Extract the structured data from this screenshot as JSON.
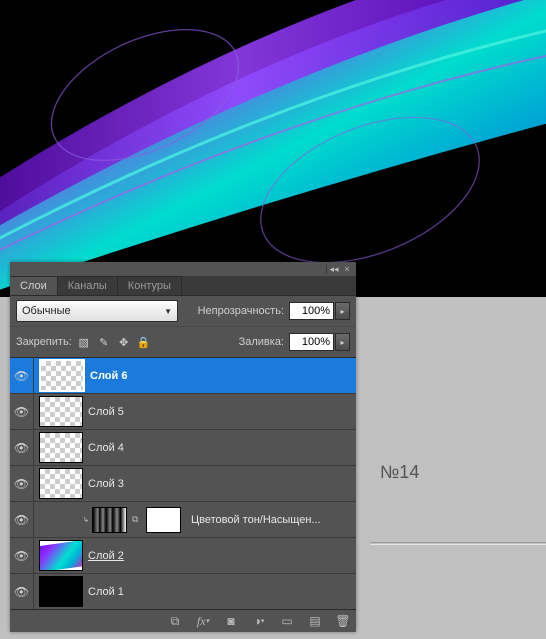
{
  "canvas": {
    "label14": "№14"
  },
  "panel": {
    "tabs": {
      "layers": "Слои",
      "channels": "Каналы",
      "paths": "Контуры"
    },
    "blend_mode": "Обычные",
    "opacity_label": "Непрозрачность:",
    "opacity_value": "100%",
    "lock_label": "Закрепить:",
    "fill_label": "Заливка:",
    "fill_value": "100%",
    "layers": [
      {
        "name": "Слой 6"
      },
      {
        "name": "Слой 5"
      },
      {
        "name": "Слой 4"
      },
      {
        "name": "Слой 3"
      },
      {
        "adjustment": "Цветовой тон/Насыщен..."
      },
      {
        "name": "Слой 2"
      },
      {
        "name": "Слой 1"
      }
    ]
  }
}
